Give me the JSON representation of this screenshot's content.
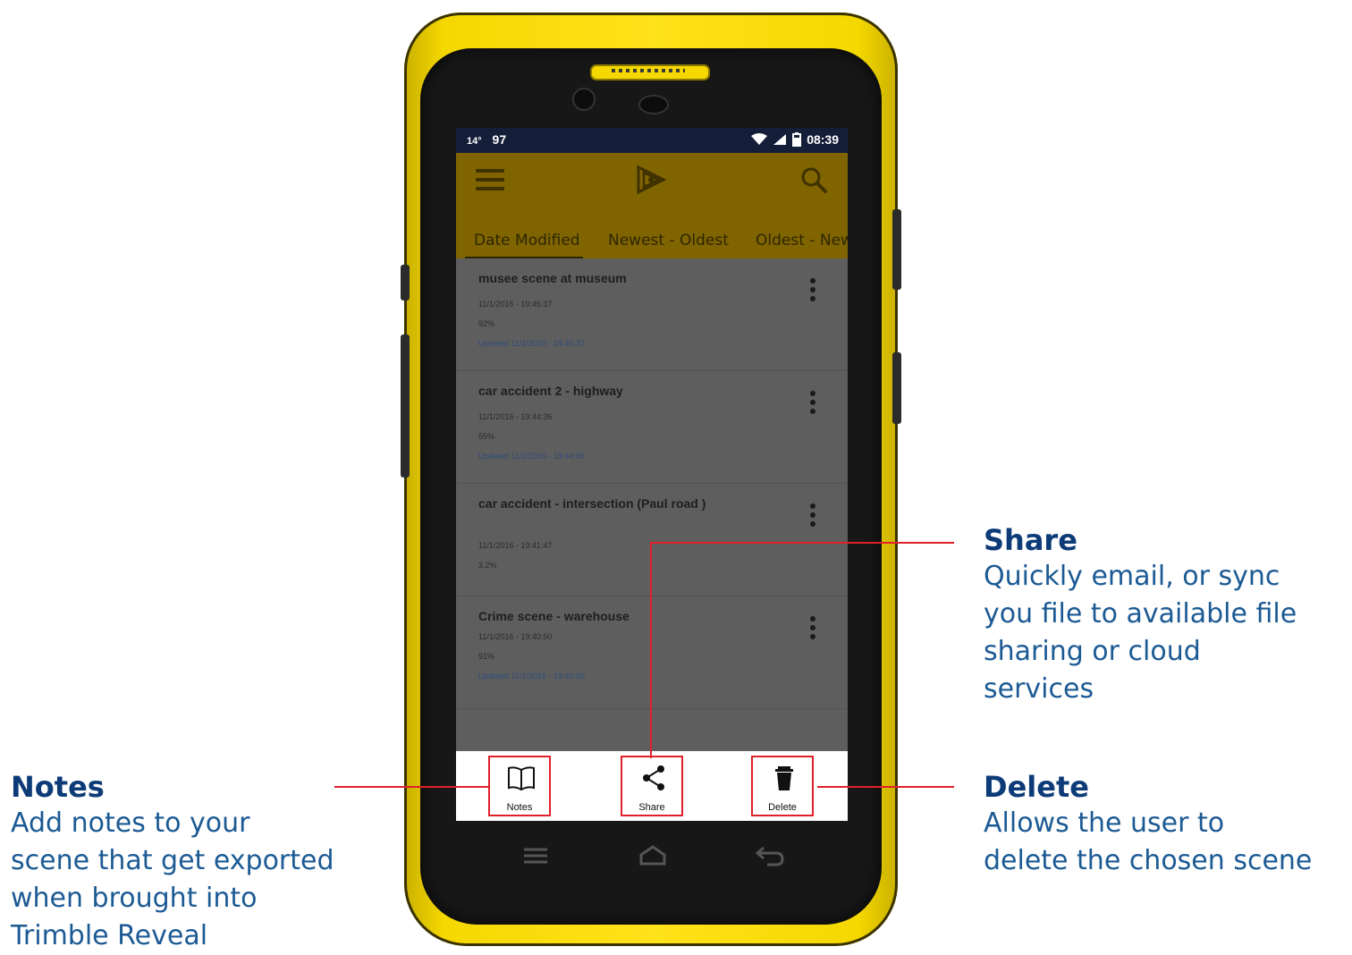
{
  "statusbar": {
    "temperature": "14°",
    "battery_level": "97",
    "time": "08:39"
  },
  "appbar": {
    "menu_icon": "hamburger-icon",
    "logo_icon": "trimble-logo-icon",
    "search_icon": "search-icon"
  },
  "tabs": [
    {
      "label": "Date Modified",
      "active": true
    },
    {
      "label": "Newest - Oldest",
      "active": false
    },
    {
      "label": "Oldest - Newest",
      "active": false
    }
  ],
  "scenes": [
    {
      "title": "musee scene at museum",
      "date": "11/1/2016 - 19:45:37",
      "size": "92%",
      "updated": "Updated 11/1/2016 - 19:45:37"
    },
    {
      "title": "car accident 2 - highway",
      "date": "11/1/2016 - 19:44:36",
      "size": "55%",
      "updated": "Updated 11/1/2016 - 19:44:36"
    },
    {
      "title": "car accident - intersection (Paul road )",
      "date": "11/1/2016 - 19:41:47",
      "size": "3.2%",
      "updated": ""
    },
    {
      "title": "Crime scene - warehouse",
      "date": "11/1/2016 - 19:40:50",
      "size": "91%",
      "updated": "Updated 11/1/2016 - 19:40:50"
    }
  ],
  "actions": {
    "notes_label": "Notes",
    "share_label": "Share",
    "delete_label": "Delete"
  },
  "callouts": {
    "share": {
      "heading": "Share",
      "lines": [
        "Quickly email, or sync",
        "you file to available file",
        "sharing or cloud",
        "services"
      ]
    },
    "notes": {
      "heading": "Notes",
      "lines": [
        "Add notes to your",
        "scene that get exported",
        "when brought into",
        "Trimble Reveal"
      ]
    },
    "delete": {
      "heading": "Delete",
      "lines": [
        "Allows the user to",
        "delete the chosen scene"
      ]
    }
  },
  "colors": {
    "phone_yellow": "#ffe21a",
    "appbar": "#7f6400",
    "callout_blue": "#0d3b78",
    "callout_line": "#e0202a"
  }
}
